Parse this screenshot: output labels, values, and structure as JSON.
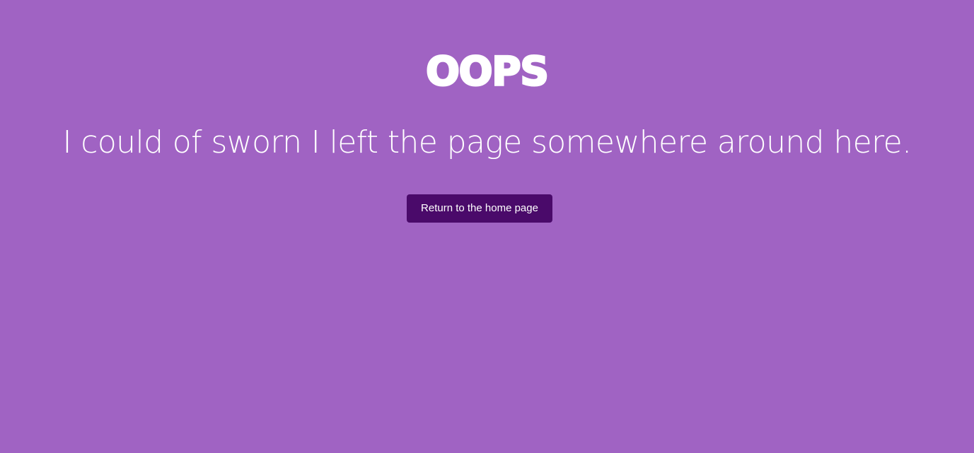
{
  "logo": {
    "text": "OOPS"
  },
  "message": {
    "text": "I could of sworn I left the page somewhere around here."
  },
  "actions": {
    "home_button_label": "Return to the home page"
  },
  "colors": {
    "background": "#a063c3",
    "button_background": "#4a0a6a",
    "text": "#ffffff"
  }
}
